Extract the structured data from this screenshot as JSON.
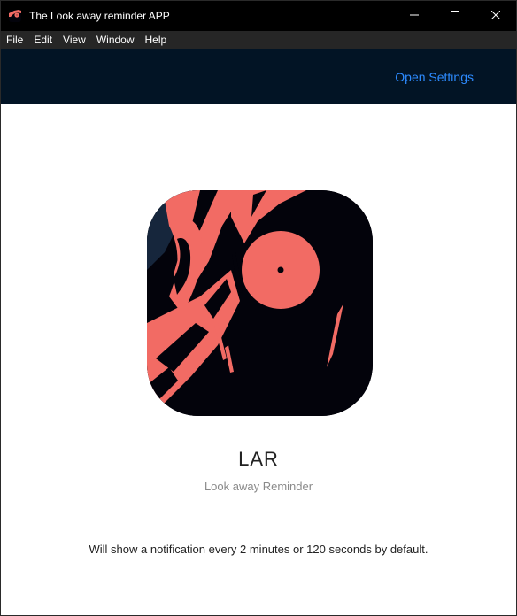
{
  "window": {
    "title": "The Look away reminder APP",
    "icon": "anime-face-icon"
  },
  "controls": {
    "minimize_icon": "minimize-icon",
    "maximize_icon": "maximize-icon",
    "close_icon": "close-icon"
  },
  "menu": {
    "items": [
      "File",
      "Edit",
      "View",
      "Window",
      "Help"
    ]
  },
  "header": {
    "settings_link": "Open Settings"
  },
  "main": {
    "logo_icon": "lar-logo-icon",
    "app_name": "LAR",
    "subtitle": "Look away Reminder",
    "description": "Will show a notification every 2 minutes or 120 seconds by default."
  },
  "colors": {
    "titlebar": "#000000",
    "menubar": "#262626",
    "header": "#021425",
    "link": "#2d8bff",
    "logo_accent": "#f26b64"
  }
}
